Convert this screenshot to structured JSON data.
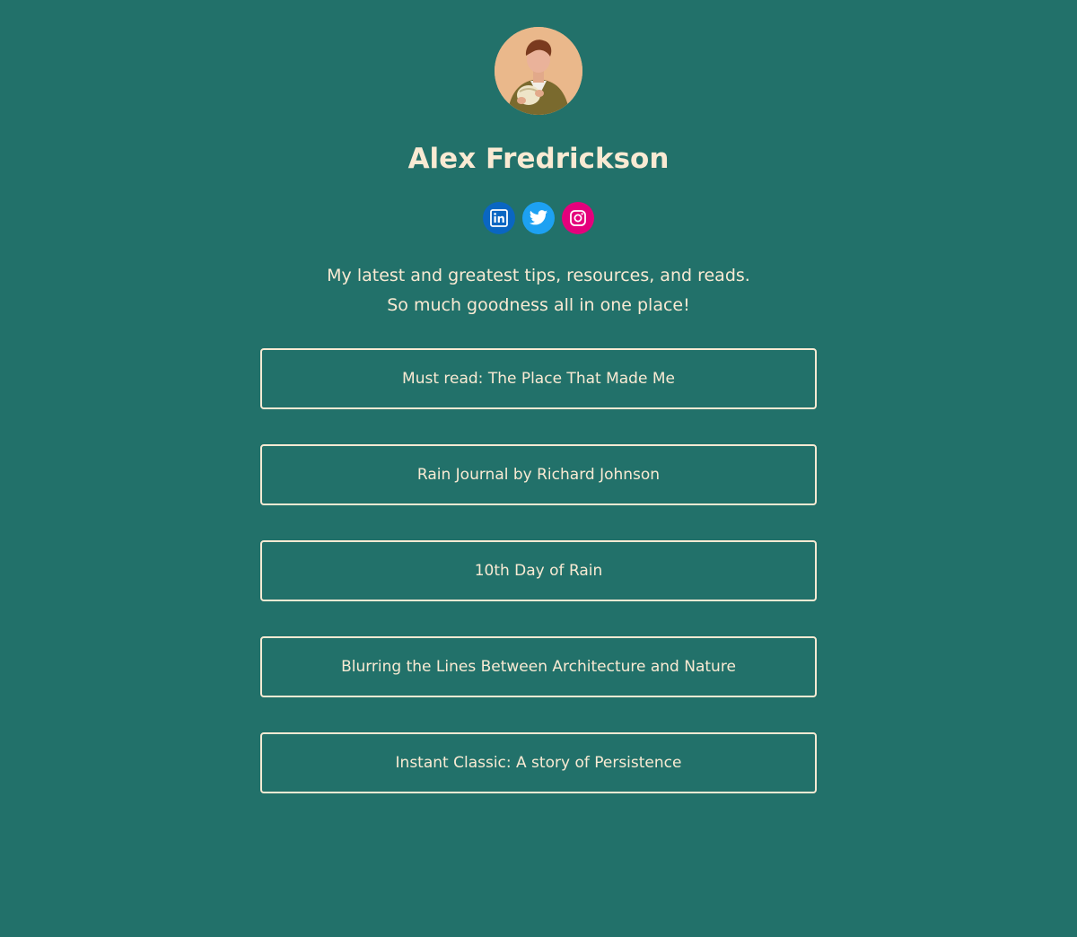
{
  "profile": {
    "name": "Alex Fredrickson",
    "avatar_alt": "avatar"
  },
  "socials": [
    {
      "icon": "linkedin-icon",
      "label": "LinkedIn",
      "color": "#0a66c2"
    },
    {
      "icon": "twitter-icon",
      "label": "Twitter",
      "color": "#1da1f2"
    },
    {
      "icon": "instagram-icon",
      "label": "Instagram",
      "color": "#e4007c"
    }
  ],
  "tagline": {
    "line1": "My latest and greatest tips, resources, and reads.",
    "line2": "So much goodness all in one place!"
  },
  "links": [
    {
      "label": "Must read: The Place That Made Me"
    },
    {
      "label": "Rain Journal by Richard Johnson"
    },
    {
      "label": "10th Day of Rain"
    },
    {
      "label": "Blurring the Lines Between Architecture and Nature"
    },
    {
      "label": "Instant Classic: A story of Persistence"
    }
  ],
  "colors": {
    "background": "#22716a",
    "text": "#f9ead3"
  }
}
